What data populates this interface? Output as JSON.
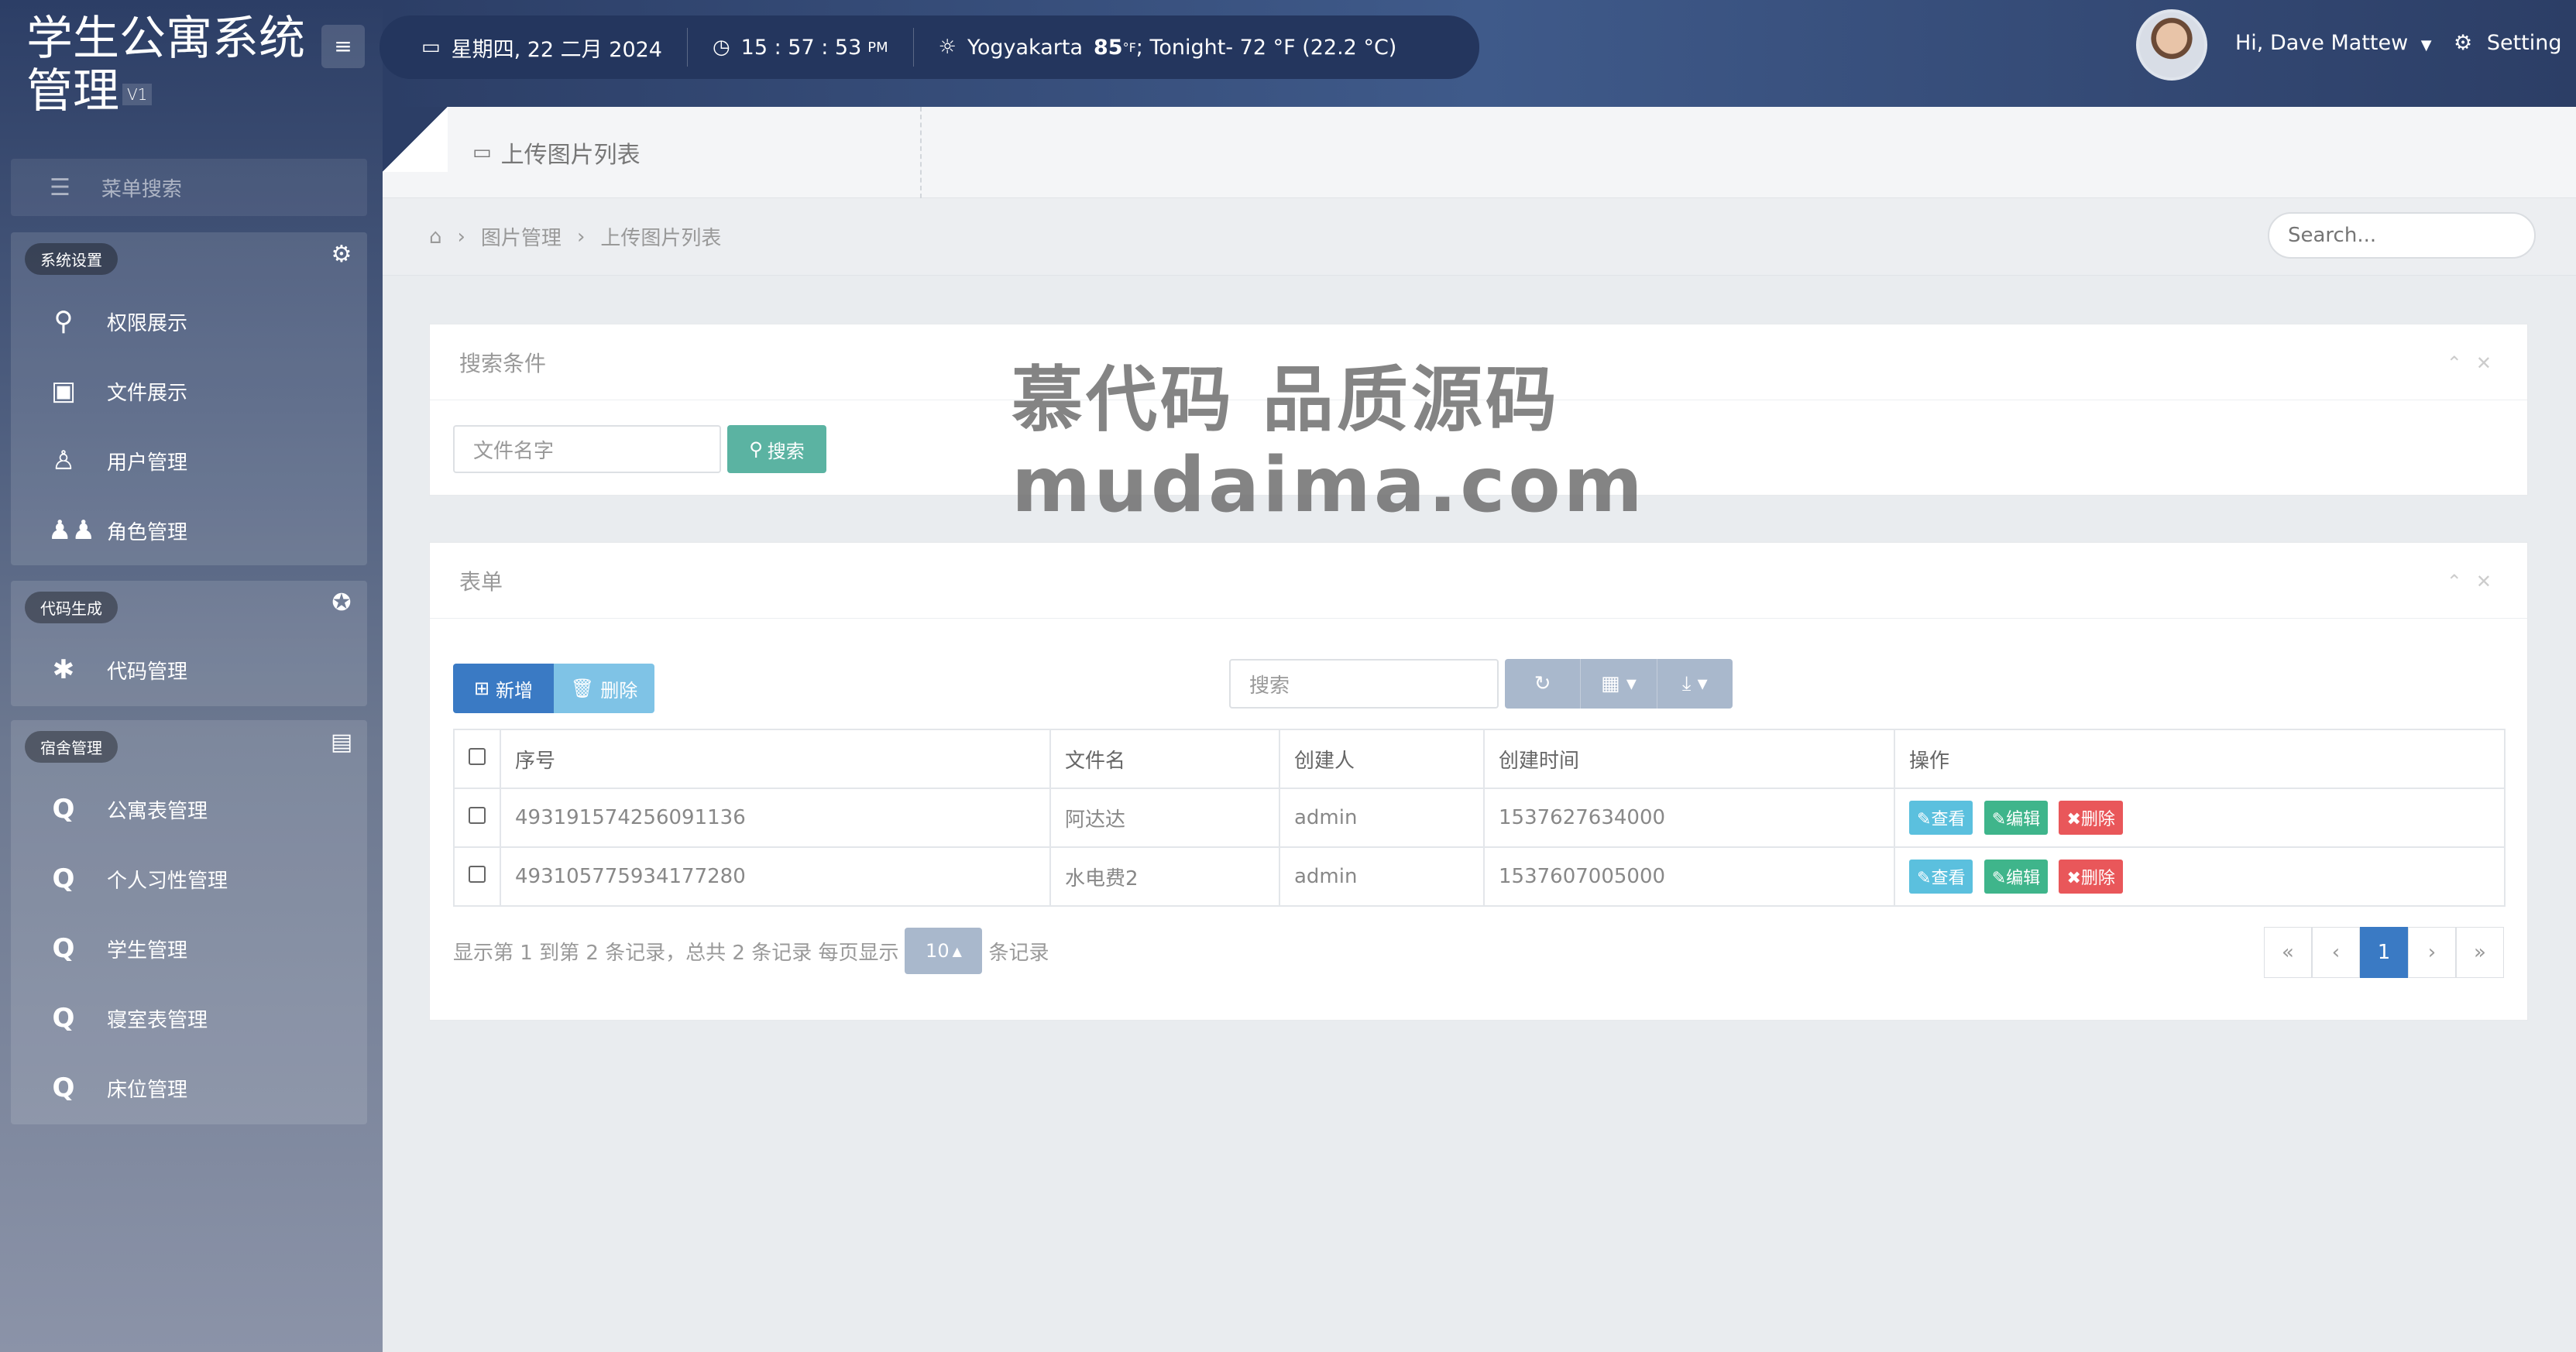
{
  "brand": {
    "title_line1": "学生公寓系统",
    "title_line2": "管理",
    "version": "V1"
  },
  "sidebar": {
    "search_label": "菜单搜索",
    "groups": [
      {
        "title": "系统设置",
        "icon": "gear-icon",
        "items": [
          {
            "label": "权限展示",
            "icon": "key-icon"
          },
          {
            "label": "文件展示",
            "icon": "image-file-icon"
          },
          {
            "label": "用户管理",
            "icon": "user-icon"
          },
          {
            "label": "角色管理",
            "icon": "users-icon"
          }
        ]
      },
      {
        "title": "代码生成",
        "icon": "rebel-icon",
        "items": [
          {
            "label": "代码管理",
            "icon": "bug-icon"
          }
        ]
      },
      {
        "title": "宿舍管理",
        "icon": "contact-book-icon",
        "items": [
          {
            "label": "公寓表管理",
            "icon": "q-icon"
          },
          {
            "label": "个人习性管理",
            "icon": "q-icon"
          },
          {
            "label": "学生管理",
            "icon": "q-icon"
          },
          {
            "label": "寝室表管理",
            "icon": "q-icon"
          },
          {
            "label": "床位管理",
            "icon": "q-icon"
          }
        ]
      }
    ]
  },
  "topbar": {
    "menu_toggle": "≡",
    "date": "星期四, 22 二月 2024",
    "time": "15 : 57 : 53",
    "time_suffix": "PM",
    "city": "Yogyakarta",
    "temp": "85",
    "temp_unit": "°F",
    "tonight": "; Tonight- 72 °F (22.2 °C)",
    "user_greeting": "Hi, Dave Mattew",
    "setting_label": "Setting"
  },
  "tab": {
    "label": "上传图片列表"
  },
  "breadcrumb": {
    "items": [
      "图片管理",
      "上传图片列表"
    ],
    "search_placeholder": "Search..."
  },
  "search_panel": {
    "title": "搜索条件",
    "filename_placeholder": "文件名字",
    "search_button": "搜索"
  },
  "table_panel": {
    "title": "表单",
    "add_button": "新增",
    "delete_button": "删除",
    "search_placeholder": "搜索",
    "columns": [
      "序号",
      "文件名",
      "创建人",
      "创建时间",
      "操作"
    ],
    "rows": [
      {
        "id": "493191574256091136",
        "filename": "阿达达",
        "creator": "admin",
        "created": "1537627634000"
      },
      {
        "id": "493105775934177280",
        "filename": "水电费2",
        "creator": "admin",
        "created": "1537607005000"
      }
    ],
    "actions": {
      "view": "查看",
      "edit": "编辑",
      "delete": "删除"
    },
    "page_info_prefix": "显示第 1 到第 2 条记录，总共 2 条记录 每页显示",
    "page_size": "10",
    "page_info_suffix": "条记录",
    "pager": [
      "«",
      "‹",
      "1",
      "›",
      "»"
    ]
  },
  "watermark": {
    "line1": "慕代码 品质源码",
    "line2": "mudaima.com"
  }
}
